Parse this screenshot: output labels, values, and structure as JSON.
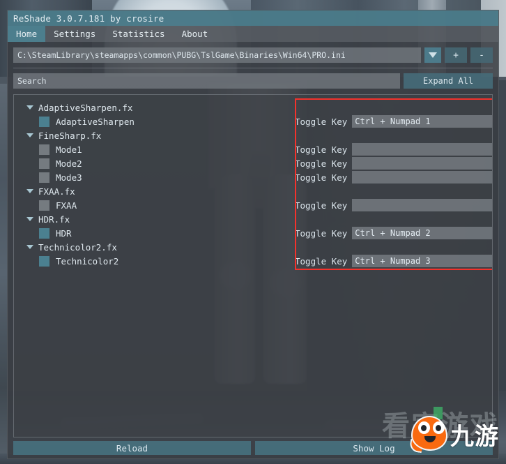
{
  "window": {
    "title": "ReShade 3.0.7.181 by crosire",
    "accent_color": "#4c8191",
    "panel_bg_color": "#393d42"
  },
  "tabs": [
    {
      "label": "Home",
      "active": true
    },
    {
      "label": "Settings",
      "active": false
    },
    {
      "label": "Statistics",
      "active": false
    },
    {
      "label": "About",
      "active": false
    }
  ],
  "preset": {
    "path": "C:\\SteamLibrary\\steamapps\\common\\PUBG\\TslGame\\Binaries\\Win64\\PRO.ini",
    "dropdown_icon": "chevron-down-icon",
    "add_label": "+",
    "remove_label": "-"
  },
  "search": {
    "value": "",
    "placeholder": "Search",
    "expand_all_label": "Expand All"
  },
  "effects": [
    {
      "type": "group",
      "label": "AdaptiveSharpen.fx",
      "expanded": true
    },
    {
      "type": "technique",
      "label": "AdaptiveSharpen",
      "checked": true
    },
    {
      "type": "group",
      "label": "FineSharp.fx",
      "expanded": true
    },
    {
      "type": "technique",
      "label": "Mode1",
      "checked": false
    },
    {
      "type": "technique",
      "label": "Mode2",
      "checked": false
    },
    {
      "type": "technique",
      "label": "Mode3",
      "checked": false
    },
    {
      "type": "group",
      "label": "FXAA.fx",
      "expanded": true
    },
    {
      "type": "technique",
      "label": "FXAA",
      "checked": false
    },
    {
      "type": "group",
      "label": "HDR.fx",
      "expanded": true
    },
    {
      "type": "technique",
      "label": "HDR",
      "checked": true
    },
    {
      "type": "group",
      "label": "Technicolor2.fx",
      "expanded": true
    },
    {
      "type": "technique",
      "label": "Technicolor2",
      "checked": true
    }
  ],
  "toggle_keys": [
    {
      "label": "Toggle Key",
      "value": "Ctrl + Numpad 1",
      "for": "AdaptiveSharpen"
    },
    {
      "label": "Toggle Key",
      "value": "",
      "for": "Mode1"
    },
    {
      "label": "Toggle Key",
      "value": "",
      "for": "Mode2"
    },
    {
      "label": "Toggle Key",
      "value": "",
      "for": "Mode3"
    },
    {
      "label": "Toggle Key",
      "value": "",
      "for": "FXAA"
    },
    {
      "label": "Toggle Key",
      "value": "Ctrl + Numpad 2",
      "for": "HDR"
    },
    {
      "label": "Toggle Key",
      "value": "Ctrl + Numpad 3",
      "for": "Technicolor2"
    }
  ],
  "annotation": {
    "color": "#f4322c",
    "shape": "rectangle"
  },
  "bottom_buttons": [
    {
      "label": "Reload"
    },
    {
      "label": "Show Log"
    }
  ],
  "watermark": {
    "brand_text": "九游",
    "ghost_text": "看家游戏",
    "mascot": "orange-blob-mascot",
    "color": "#f96a10"
  }
}
